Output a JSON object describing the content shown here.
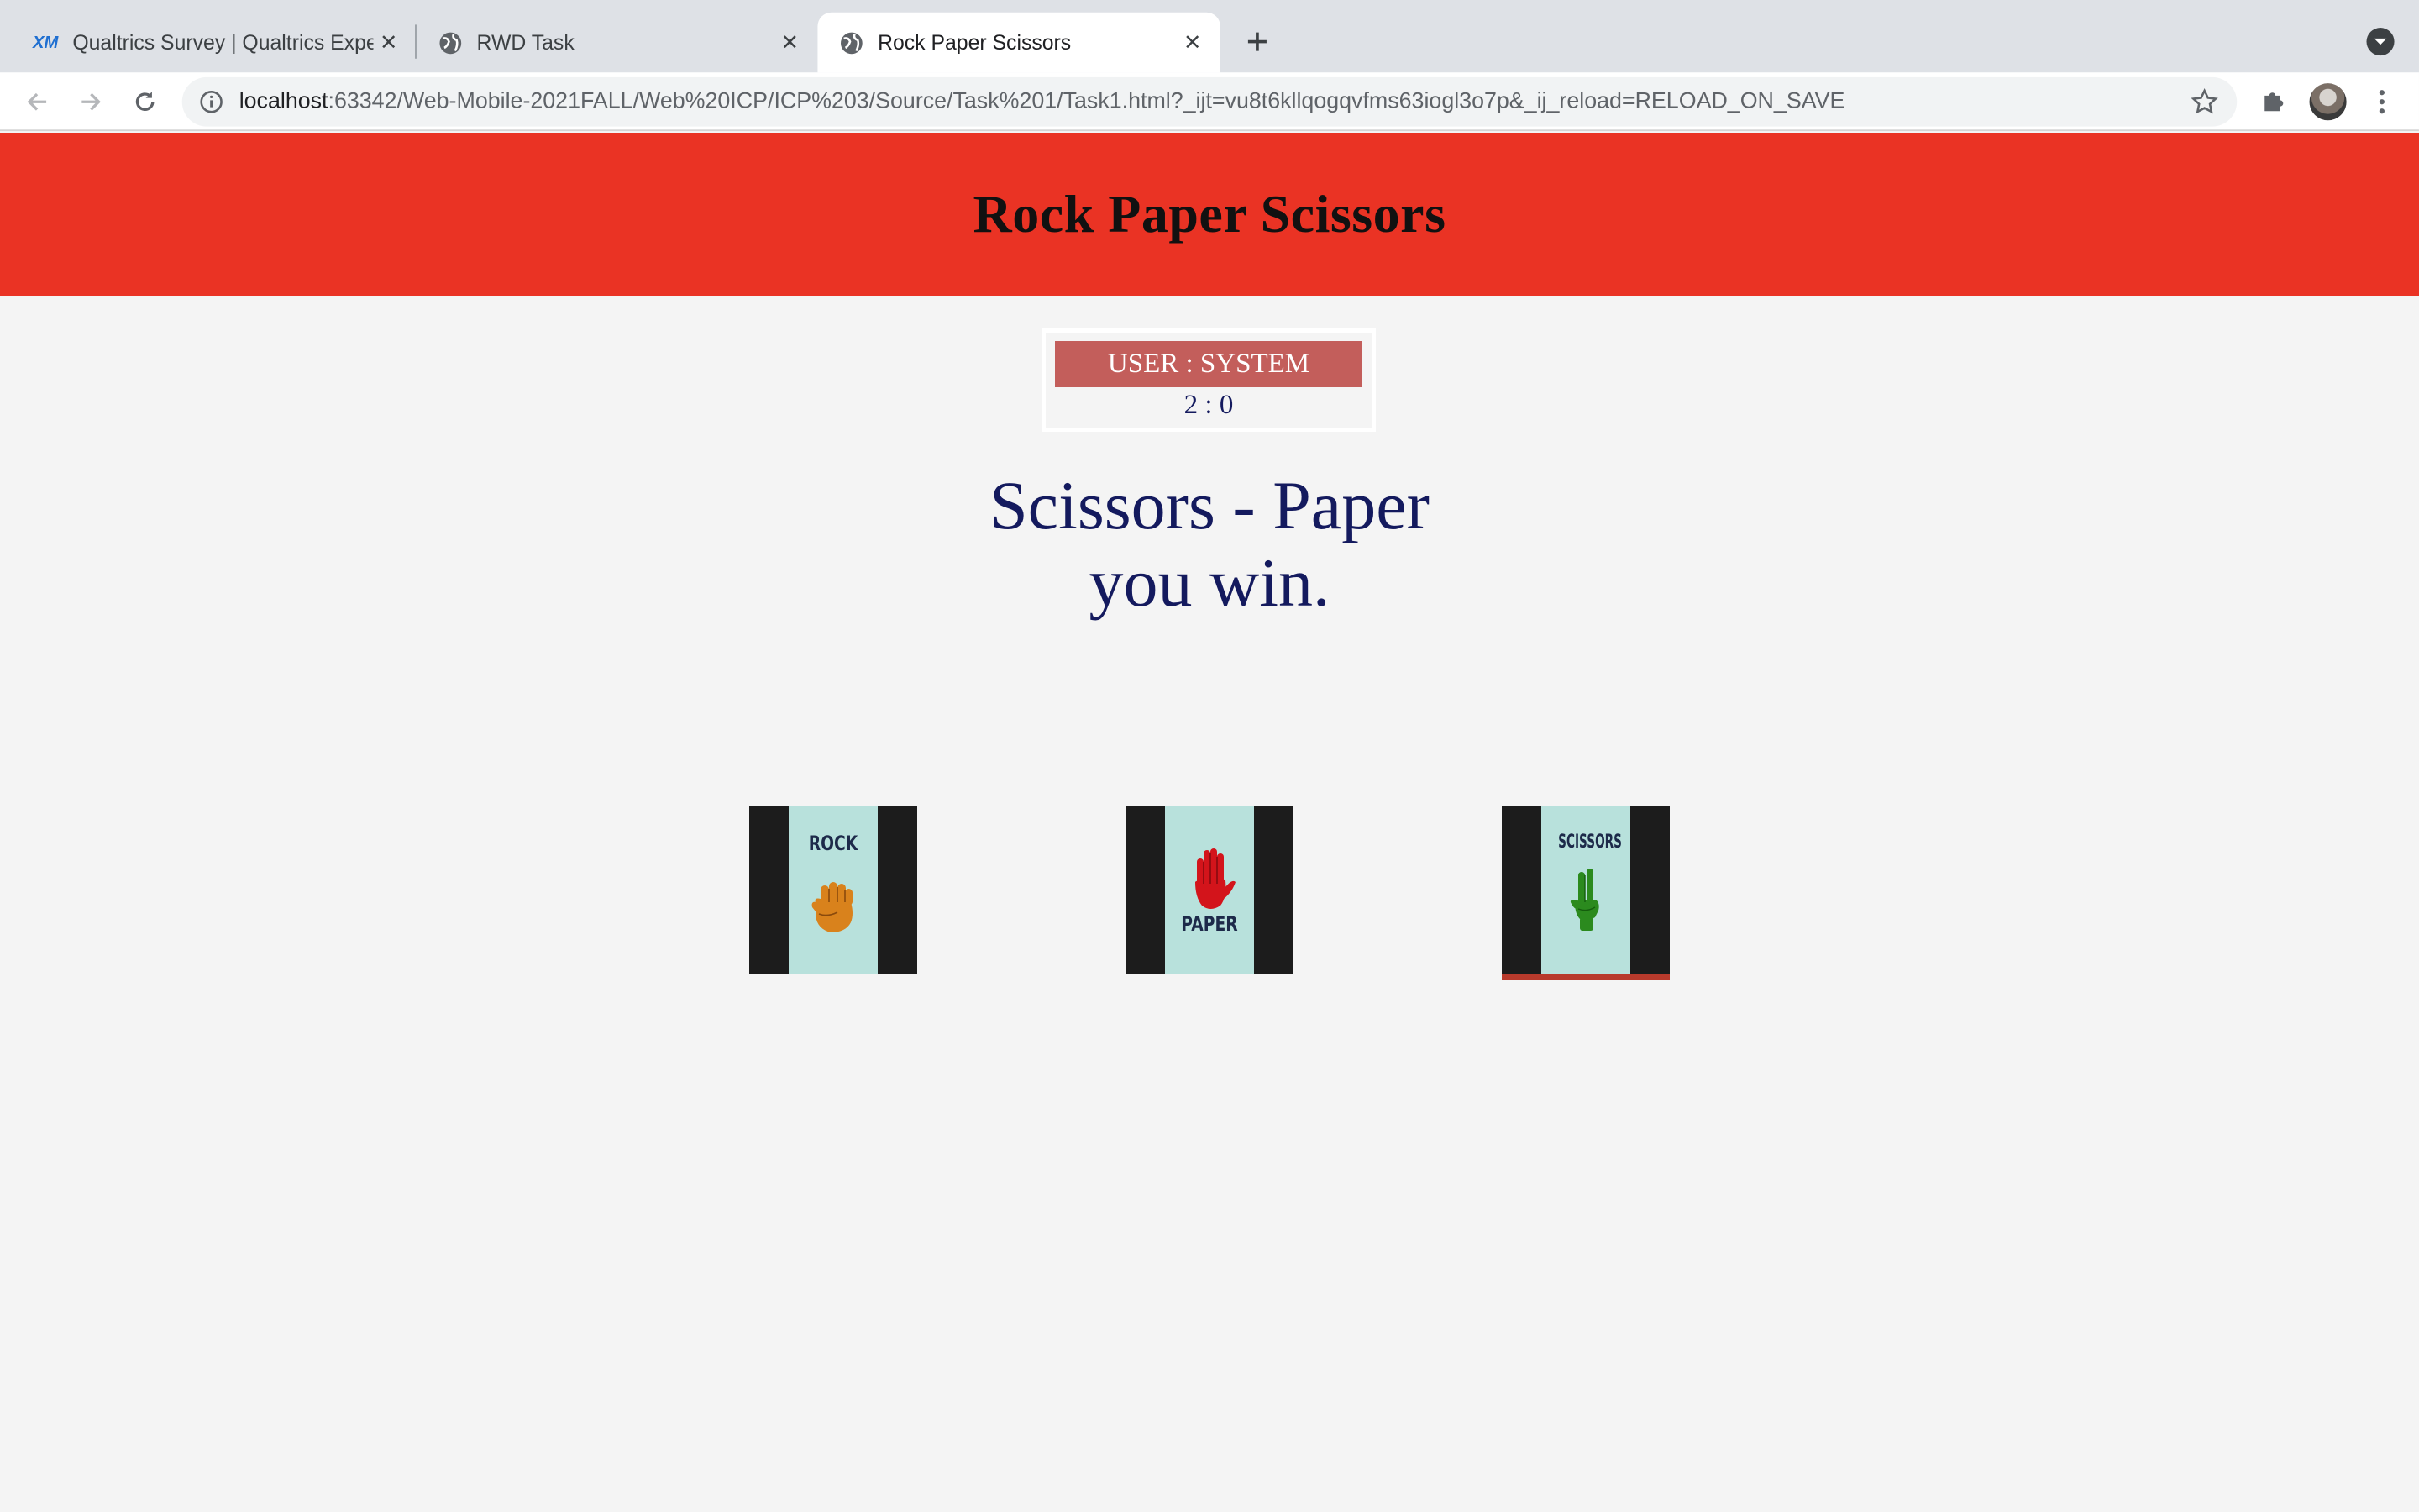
{
  "browser": {
    "tabs": [
      {
        "title": "Qualtrics Survey | Qualtrics Experience Management",
        "favicon": "qualtrics-xm-icon",
        "favicon_text": "XM",
        "active": false
      },
      {
        "title": "RWD Task",
        "favicon": "globe-icon",
        "active": false
      },
      {
        "title": "Rock Paper Scissors",
        "favicon": "globe-icon",
        "active": true
      }
    ],
    "url_host": "localhost",
    "url_rest": ":63342/Web-Mobile-2021FALL/Web%20ICP/ICP%203/Source/Task%201/Task1.html?_ijt=vu8t6kllqogqvfms63iogl3o7p&_ij_reload=RELOAD_ON_SAVE"
  },
  "page": {
    "title": "Rock Paper Scissors",
    "score_label": "USER : SYSTEM",
    "score_value": "2 : 0",
    "result_line1": "Scissors - Paper",
    "result_line2": "you win.",
    "choices": [
      {
        "label": "ROCK",
        "icon": "fist-icon",
        "color": "#d9821c",
        "selected": false
      },
      {
        "label": "PAPER",
        "icon": "open-hand-icon",
        "color": "#d3141b",
        "selected": false
      },
      {
        "label": "SCISSORS",
        "icon": "peace-hand-icon",
        "color": "#2b8a1e",
        "selected": true
      }
    ]
  },
  "colors": {
    "header": "#ea3324",
    "score_header": "#c35e5b",
    "text_navy": "#141a5e",
    "card_panel": "#b8e1dc"
  }
}
